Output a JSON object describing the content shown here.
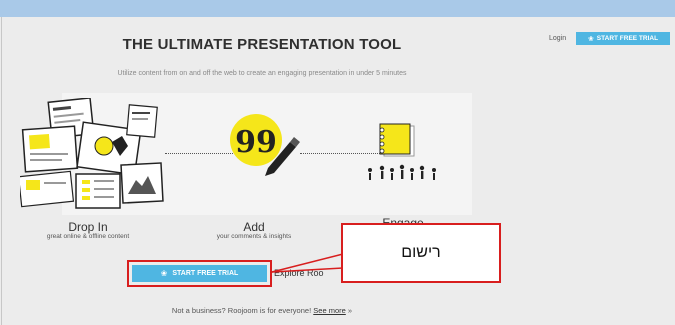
{
  "header": {
    "login_label": "Login",
    "trial_label": "START FREE TRIAL",
    "title": "THE ULTIMATE PRESENTATION TOOL",
    "subtitle": "Utilize content from on and off the web to create an engaging presentation in under 5 minutes"
  },
  "steps": [
    {
      "title": "Drop In",
      "subtitle": "great online & offline content",
      "icon": "collage-illustration"
    },
    {
      "title": "Add",
      "subtitle": "your comments & insights",
      "icon": "quote-pen-illustration"
    },
    {
      "title": "Engage",
      "subtitle": "",
      "icon": "audience-illustration"
    }
  ],
  "cta": {
    "trial_label": "START FREE TRIAL",
    "explore_label": "Explore Roo"
  },
  "callout": {
    "text": "רישום"
  },
  "footer": {
    "text": "Not a business? Roojoom is for everyone!",
    "link": "See more",
    "arrows": "»"
  },
  "colors": {
    "accent": "#4fb6e2",
    "highlight": "#f5e61a",
    "annotation": "#d81e1e",
    "top_strip": "#a9c9e8"
  }
}
